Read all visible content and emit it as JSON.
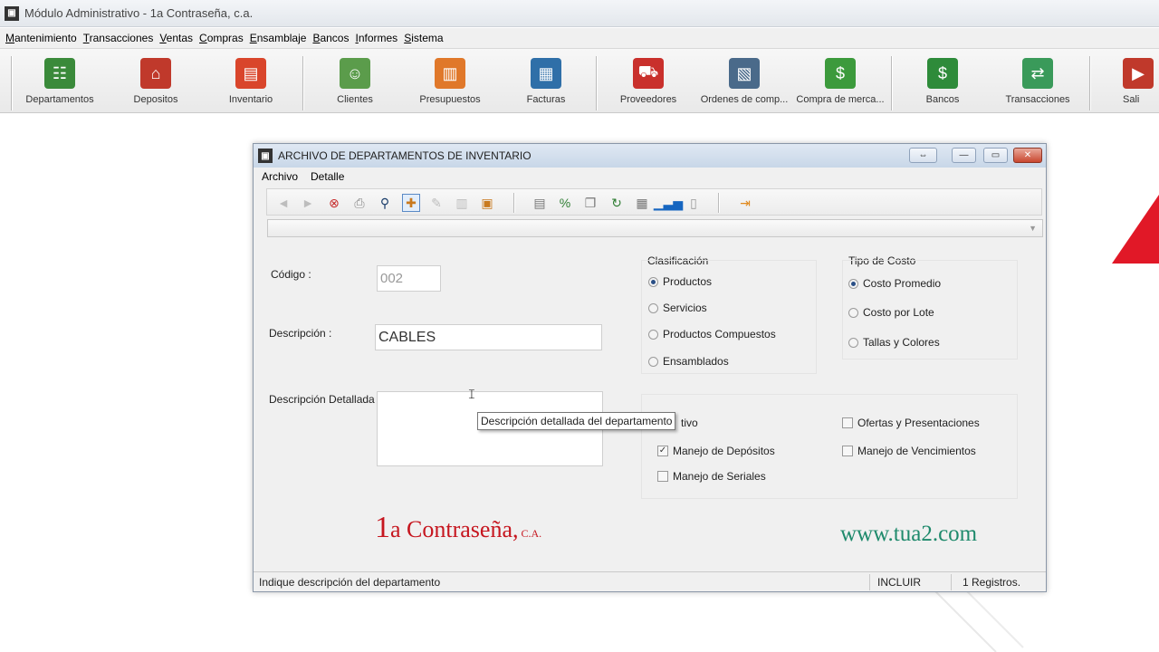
{
  "app": {
    "title": "Módulo Administrativo - 1a Contraseña, c.a."
  },
  "menu": [
    "Mantenimiento",
    "Transacciones",
    "Ventas",
    "Compras",
    "Ensamblaje",
    "Bancos",
    "Informes",
    "Sistema"
  ],
  "toolbar": {
    "buttons": [
      {
        "label": "Departamentos",
        "icon": "departments-icon",
        "color": "#3a8a3a"
      },
      {
        "label": "Depositos",
        "icon": "warehouse-icon",
        "color": "#c0392b"
      },
      {
        "label": "Inventario",
        "icon": "inventory-icon",
        "color": "#d9452b"
      },
      {
        "label": "Clientes",
        "icon": "clients-icon",
        "color": "#5b9c4b"
      },
      {
        "label": "Presupuestos",
        "icon": "budget-icon",
        "color": "#e0782a"
      },
      {
        "label": "Facturas",
        "icon": "invoice-icon",
        "color": "#2f6fa8"
      },
      {
        "label": "Proveedores",
        "icon": "supplier-truck-icon",
        "color": "#c9302c"
      },
      {
        "label": "Ordenes de comp...",
        "icon": "purchase-order-icon",
        "color": "#4a6a8a"
      },
      {
        "label": "Compra de merca...",
        "icon": "money-purchase-icon",
        "color": "#3c9a3c"
      },
      {
        "label": "Bancos",
        "icon": "money-bag-icon",
        "color": "#2e8b3a"
      },
      {
        "label": "Transacciones",
        "icon": "transactions-icon",
        "color": "#3a9a5a"
      },
      {
        "label": "Sali",
        "icon": "exit-icon",
        "color": "#c0392b"
      }
    ]
  },
  "dialog": {
    "title": "ARCHIVO DE DEPARTAMENTOS DE INVENTARIO",
    "menu": [
      "Archivo",
      "Detalle"
    ],
    "fields": {
      "codigo_label": "Código :",
      "codigo_value": "002",
      "descripcion_label": "Descripción :",
      "descripcion_value": "CABLES",
      "descripcion_detallada_label": "Descripción Detallada :",
      "descripcion_detallada_value": ""
    },
    "clasificacion": {
      "title": "Clasificación",
      "options": [
        "Productos",
        "Servicios",
        "Productos Compuestos",
        "Ensamblados"
      ],
      "selected": "Productos"
    },
    "tipo_costo": {
      "title": "Tipo de Costo",
      "options": [
        "Costo Promedio",
        "Costo por Lote",
        "Tallas y Colores"
      ],
      "selected": "Costo Promedio"
    },
    "checks": {
      "activo_partial": "tivo",
      "manejo_depositos": "Manejo de Depósitos",
      "manejo_seriales": "Manejo de Seriales",
      "ofertas": "Ofertas y Presentaciones",
      "vencimientos": "Manejo de Vencimientos"
    },
    "tooltip": "Descripción detallada del departamento",
    "brand_left_big": "1",
    "brand_left_main": "a Contraseña,",
    "brand_left_small": " C.A.",
    "brand_right": "www.tua2.com",
    "status": {
      "message": "Indique descripción del departamento",
      "mode": "INCLUIR",
      "records": "1 Registros."
    }
  }
}
